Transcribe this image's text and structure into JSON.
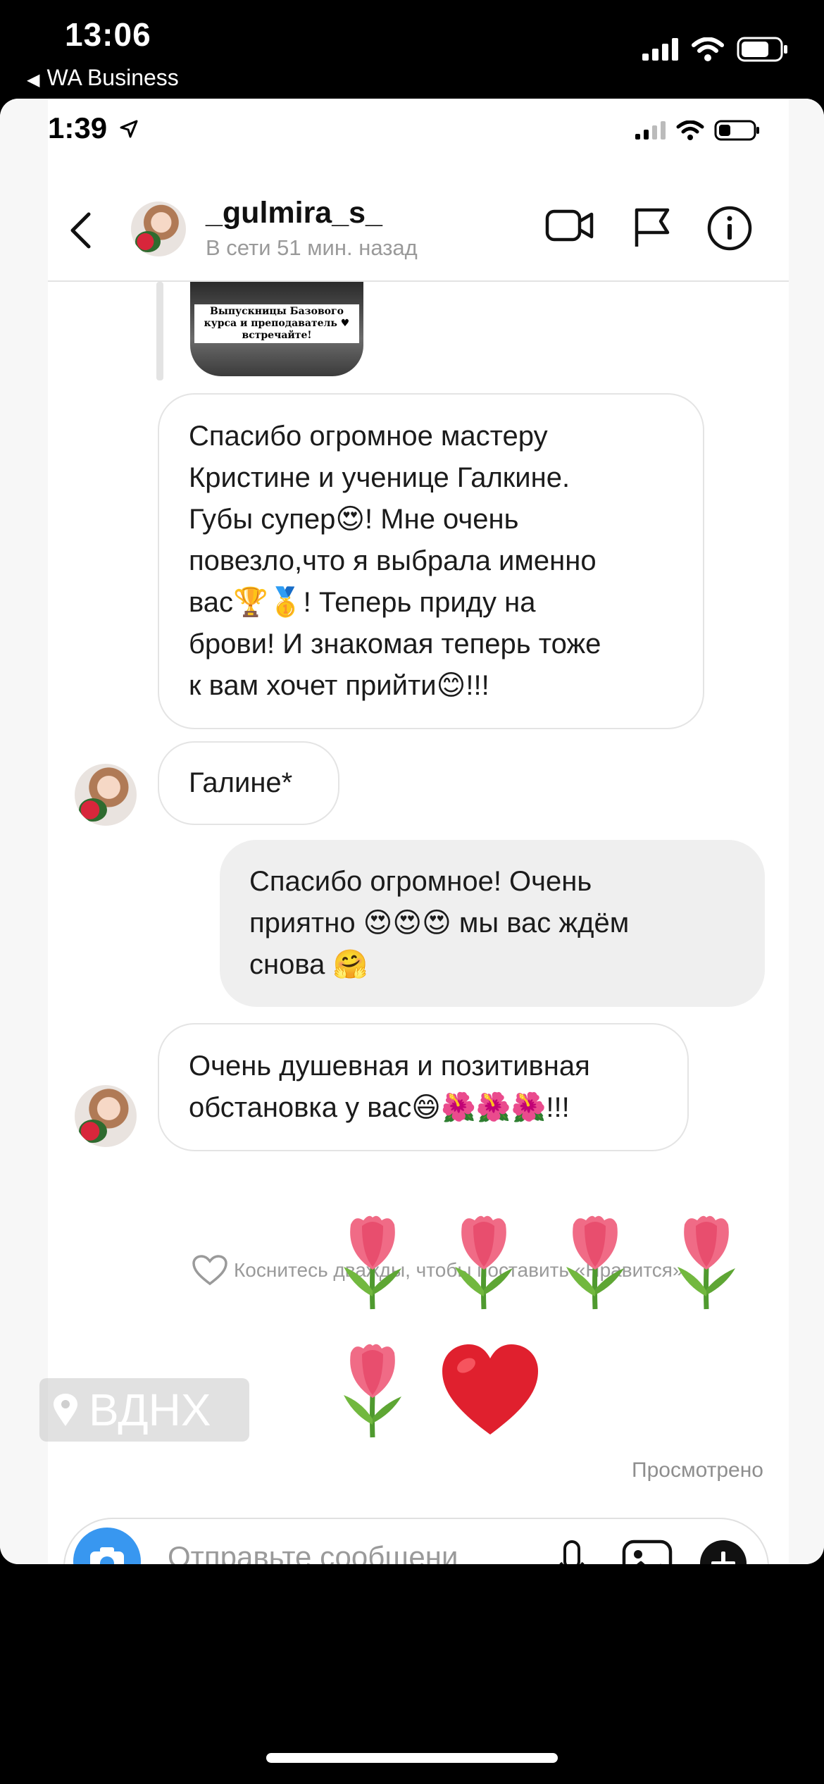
{
  "outer_status": {
    "time": "13:06",
    "back_app": "WA Business"
  },
  "inner_status": {
    "time": "1:39"
  },
  "header": {
    "username": "_gulmira_s_",
    "last_seen": "В сети 51 мин. назад",
    "icons": [
      "chevron-left-icon",
      "video-call-icon",
      "flag-icon",
      "info-icon"
    ]
  },
  "shared_post": {
    "caption": "Выпускницы Базового курса и преподаватель ♥ встречайте!"
  },
  "messages": [
    {
      "side": "received",
      "lines": [
        "Спасибо огромное мастеру",
        "Кристине и ученице Галкине.",
        "Губы супер😍! Мне очень",
        "повезло,что я выбрала именно",
        "вас🏆🥇!   Теперь приду на",
        "брови! И знакомая теперь тоже",
        "к вам хочет прийти😊!!!"
      ]
    },
    {
      "side": "received",
      "lines": [
        "Галине*"
      ]
    },
    {
      "side": "sent",
      "lines": [
        "Спасибо огромное! Очень",
        "приятно 😍😍😍 мы вас ждём",
        "снова 🤗"
      ]
    },
    {
      "side": "received",
      "lines": [
        "Очень душевная и позитивная",
        "обстановка у вас😄🌺🌺🌺!!!"
      ]
    }
  ],
  "like_hint": "Коснитесь дважды, чтобы поставить «Нравится»",
  "emoji_message": {
    "tulips": 5,
    "hearts": 1
  },
  "location_sticker": "ВДНХ",
  "seen_label": "Просмотрено",
  "composer": {
    "placeholder": "Отправьте сообщени"
  },
  "colors": {
    "accent": "#3897f0",
    "sent_bubble": "#efefef",
    "heart": "#e0202e"
  }
}
